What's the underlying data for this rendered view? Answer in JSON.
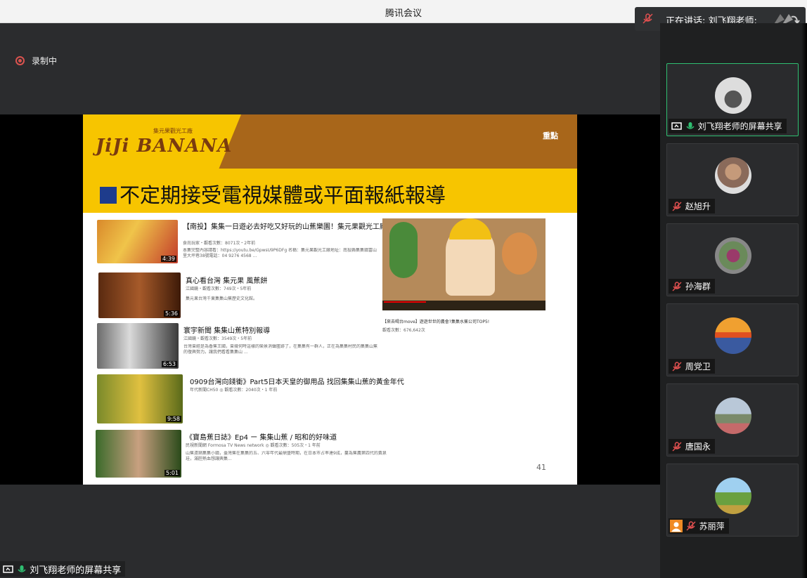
{
  "window": {
    "title": "腾讯会议"
  },
  "speaking": {
    "label": "正在讲话: 刘飞翔老师;"
  },
  "recording": {
    "label": "录制中"
  },
  "share_label": "刘飞翔老师的屏幕共享",
  "slide": {
    "logo": "JiJi BANANA",
    "logo_sub": "集元果觀光工廠",
    "tag": "重點",
    "headline": "不定期接受電視媒體或平面報紙報導",
    "page_number": "41",
    "videos": [
      {
        "title": "【南投】集集一日遊必去好吃又好玩的山蕉樂園！集元果觀光工廠 食尚玩家",
        "meta": "食尚玩家・觀看次數：8071次・2年前",
        "desc": "本集完整內容請看：https://youtu.be/GpwsU9P6DFg 名稱：集元果觀光工廠地址：南投縣集集鎮富山里大坪巷38號電話：04 9276 4568 ...",
        "duration": "4:39"
      },
      {
        "title": "真心看台灣 集元果 風蕉餅",
        "meta": "江國鏡・觀看次數：749次・5年前",
        "desc": "集元果台灣千東集集山蕉歷史文化館。",
        "duration": "5:36"
      },
      {
        "title": "寰宇新聞 集集山蕉特別報導",
        "meta": "江國鏡・觀看次數：3549次・5年前",
        "desc": "台灣曾經是為香蕉王國，曾幾何時這樣的榮景消聲匿跡了，在集集有一群人，正在為集集村民的集集山蕉的復興努力。讓我們看看集集山 ...",
        "duration": "6:53"
      },
      {
        "title": "0909台灣向錢衝》Part5日本天皇的御用品 找回集集山蕉的黃金年代",
        "meta": "年代新聞CH50 ◎ 觀看次數：2040次・1 年前",
        "desc": "",
        "duration": "9:58"
      },
      {
        "title": "《寶島蕉日誌》Ep4 ー 集集山蕉 / 昭和的好味道",
        "meta": "民視新聞網 Formosa TV News network ◎ 觀看次數：505次・1 年前",
        "desc": "山蕉遠銷集集小鎮，臺灣蕉在集集的五、六零年代最鼎盛時期，在日本市占率達9成，蔓為蕉農第四代的黃泉珪，滿腔熱血想讓興集...",
        "duration": "5:01"
      }
    ],
    "big_video": {
      "caption": "【來去喝台move】遊遊世世的農會?集集水蕉公司TOP5!",
      "meta": "觀看次數：676,642次"
    }
  },
  "participants": [
    {
      "name": "刘飞翔老师的屏幕共享",
      "active": true
    },
    {
      "name": "赵旭升",
      "active": false
    },
    {
      "name": "孙海群",
      "active": false
    },
    {
      "name": "周党卫",
      "active": false
    },
    {
      "name": "唐国永",
      "active": false
    },
    {
      "name": "苏丽萍",
      "active": false
    }
  ],
  "colors": {
    "accent_green": "#2fbf71",
    "record_red": "#d9534f",
    "slide_yellow": "#f7c500",
    "slide_brown": "#a8661a"
  }
}
